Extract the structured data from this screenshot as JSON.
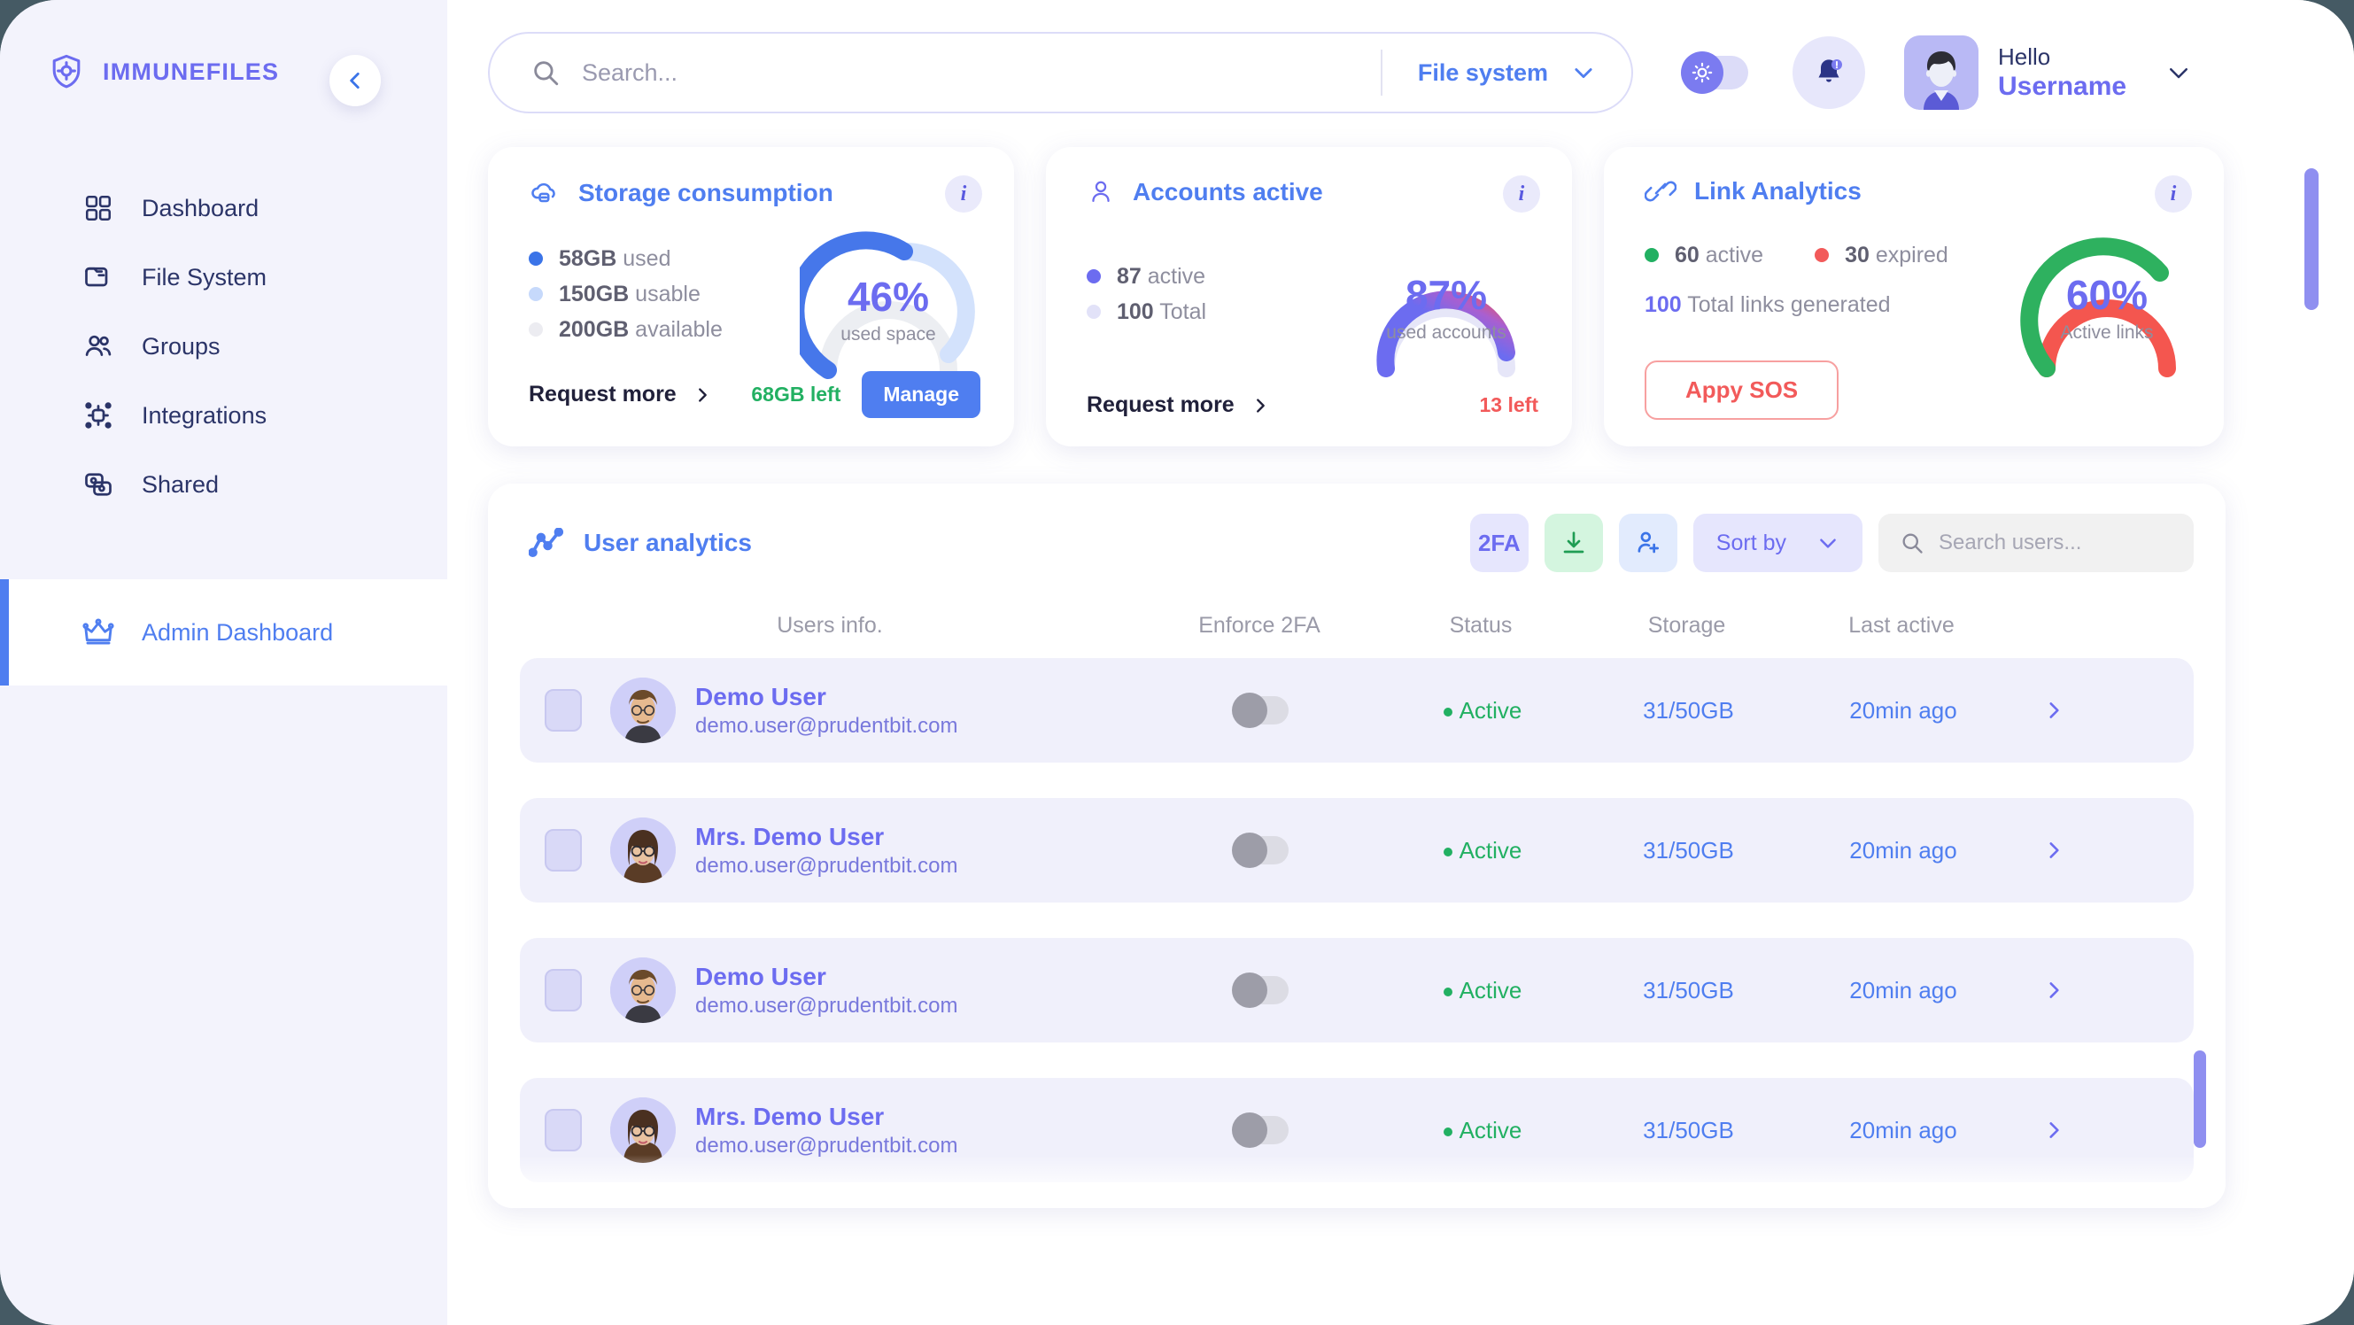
{
  "brand": {
    "name": "IMMUNEFILES",
    "logo_icon": "shield-virus-icon",
    "collapse_icon": "chevron-left-icon"
  },
  "sidebar": {
    "items": [
      {
        "label": "Dashboard",
        "icon": "grid-icon",
        "active": false
      },
      {
        "label": "File System",
        "icon": "folder-icon",
        "active": false
      },
      {
        "label": "Groups",
        "icon": "users-icon",
        "active": false
      },
      {
        "label": "Integrations",
        "icon": "integrations-icon",
        "active": false
      },
      {
        "label": "Shared",
        "icon": "shared-icon",
        "active": false
      }
    ],
    "admin": {
      "label": "Admin Dashboard",
      "icon": "crown-icon",
      "active": true
    }
  },
  "topbar": {
    "search_placeholder": "Search...",
    "search_value": "",
    "search_icon": "search-icon",
    "scope_label": "File system",
    "scope_chevron": "chevron-down-icon",
    "theme_toggle_icon": "sun-icon",
    "theme_toggle_on": false,
    "bell_icon": "bell-icon",
    "bell_has_alert": true,
    "greeting": "Hello",
    "username": "Username",
    "user_chevron": "chevron-down-icon",
    "avatar_icon": "avatar-icon"
  },
  "cards": {
    "storage": {
      "title": "Storage consumption",
      "icon": "cloud-storage-icon",
      "info_icon": "info-icon",
      "legend": [
        {
          "value": "58GB",
          "label": "used",
          "color": "#3b74e8"
        },
        {
          "value": "150GB",
          "label": "usable",
          "color": "#c6d9fb"
        },
        {
          "value": "200GB",
          "label": "available",
          "color": "#ececf1"
        }
      ],
      "gauge": {
        "percent": 46,
        "pct_text": "46%",
        "sub": "used space",
        "arc_used_color": "#4677ea",
        "arc_usable_color": "#d3e2fc",
        "arc_rest_color": "#eceef2"
      },
      "request_more": "Request more",
      "request_more_icon": "chevron-right-icon",
      "left_note": "68GB left",
      "left_note_color": "#22b062",
      "manage_label": "Manage",
      "manage_color": "#4f7ef0"
    },
    "accounts": {
      "title": "Accounts active",
      "icon": "person-icon",
      "info_icon": "info-icon",
      "legend": [
        {
          "value": "87",
          "label": "active",
          "color": "#6c6cf0"
        },
        {
          "value": "100",
          "label": "Total",
          "color": "#e2e2f8"
        }
      ],
      "gauge": {
        "percent": 87,
        "pct_text": "87%",
        "sub": "used accounts",
        "arc_start_color": "#6c6cf0",
        "arc_end_color": "#f3524f",
        "arc_rest_color": "#e6e6f8"
      },
      "request_more": "Request more",
      "request_more_icon": "chevron-right-icon",
      "left_note": "13 left",
      "left_note_color": "#f25a5a"
    },
    "links": {
      "title": "Link Analytics",
      "icon": "link-icon",
      "info_icon": "info-icon",
      "legend": [
        {
          "value": "60",
          "label": "active",
          "color": "#22b062"
        },
        {
          "value": "30",
          "label": "expired",
          "color": "#f25a5a"
        }
      ],
      "total_value": "100",
      "total_label": "Total links generated",
      "gauge": {
        "percent": 60,
        "pct_text": "60%",
        "sub": "Active links",
        "arc_active_color": "#2eb15f",
        "arc_expired_color": "#f4564f"
      },
      "sos_label": "Appy SOS",
      "sos_color": "#f25a5a"
    }
  },
  "users_panel": {
    "title": "User analytics",
    "title_icon": "line-chart-icon",
    "tools": {
      "twofa_label": "2FA",
      "twofa_icon": "2fa-icon",
      "download_icon": "download-icon",
      "add_user_icon": "add-user-icon",
      "sort_label": "Sort by",
      "sort_chevron": "chevron-down-icon",
      "search_placeholder": "Search users...",
      "search_value": "",
      "search_icon": "search-icon"
    },
    "columns": [
      "Users info.",
      "Enforce 2FA",
      "Status",
      "Storage",
      "Last active"
    ],
    "rows": [
      {
        "name": "Demo User",
        "email": "demo.user@prudentbit.com",
        "avatar": "avatar-man-icon",
        "enforce_2fa": false,
        "status": "Active",
        "storage": "31/50GB",
        "last_active": "20min ago",
        "chevron": "chevron-right-icon",
        "checked": false
      },
      {
        "name": "Mrs. Demo User",
        "email": "demo.user@prudentbit.com",
        "avatar": "avatar-woman-icon",
        "enforce_2fa": false,
        "status": "Active",
        "storage": "31/50GB",
        "last_active": "20min ago",
        "chevron": "chevron-right-icon",
        "checked": false
      },
      {
        "name": "Demo User",
        "email": "demo.user@prudentbit.com",
        "avatar": "avatar-man-icon",
        "enforce_2fa": false,
        "status": "Active",
        "storage": "31/50GB",
        "last_active": "20min ago",
        "chevron": "chevron-right-icon",
        "checked": false
      },
      {
        "name": "Mrs. Demo User",
        "email": "demo.user@prudentbit.com",
        "avatar": "avatar-woman-icon",
        "enforce_2fa": false,
        "status": "Active",
        "storage": "31/50GB",
        "last_active": "20min ago",
        "chevron": "chevron-right-icon",
        "checked": false
      }
    ]
  },
  "theme": {
    "accent_blue": "#4f7ef0",
    "accent_purple": "#6c6cf0",
    "green": "#22b062",
    "red": "#f25a5a",
    "sidebar_bg": "#f3f3fc",
    "row_bg": "#f0f0fb"
  }
}
